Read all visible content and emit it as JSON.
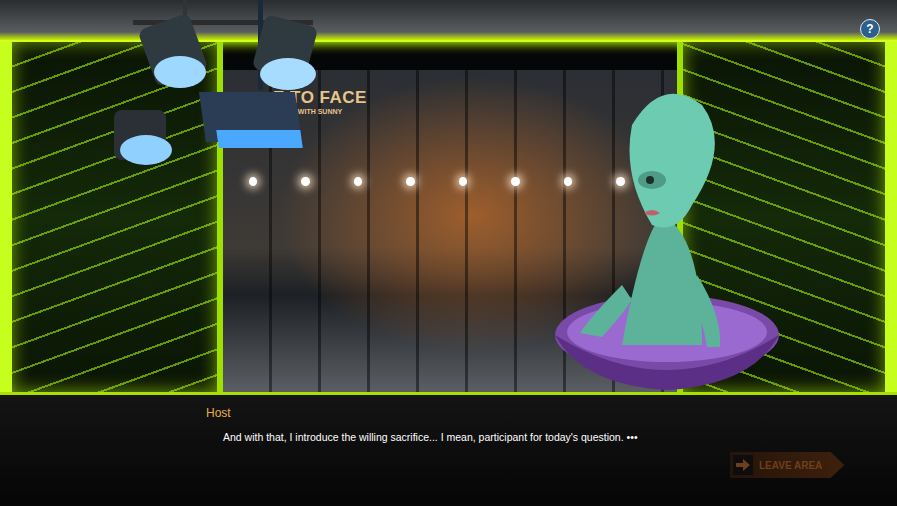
{
  "backdrop": {
    "title": "E TO FACE",
    "subtitle": "WITH SUNNY"
  },
  "dialog": {
    "speaker": "Host",
    "text": "And with that, I introduce the willing sacrifice... I mean, participant for today's question.",
    "more": "•••"
  },
  "buttons": {
    "leave": {
      "label": "LEAVE AREA",
      "disabled": true
    },
    "help": "?"
  }
}
